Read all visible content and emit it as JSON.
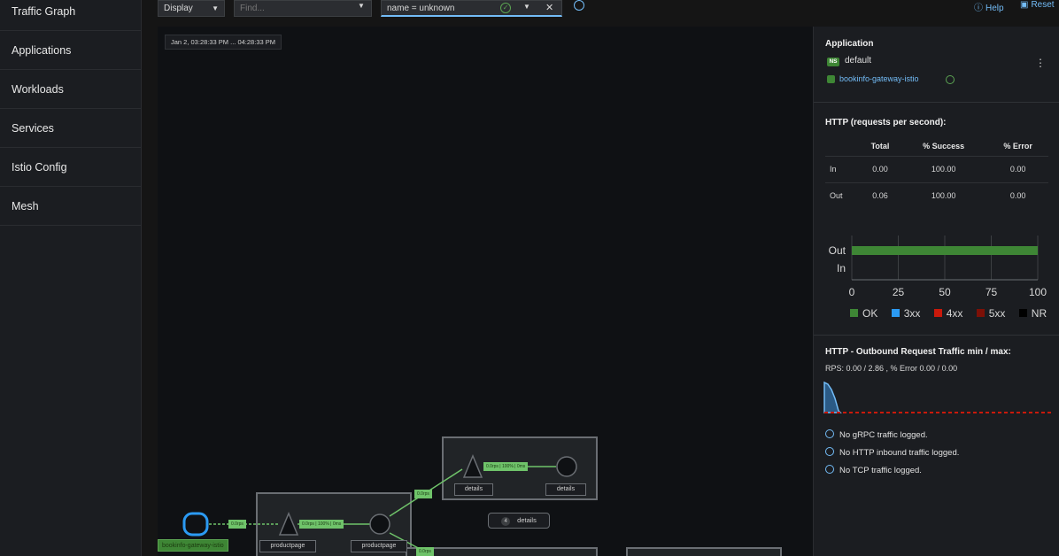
{
  "sidebar": {
    "items": [
      {
        "label": "Traffic Graph"
      },
      {
        "label": "Applications"
      },
      {
        "label": "Workloads"
      },
      {
        "label": "Services"
      },
      {
        "label": "Istio Config"
      },
      {
        "label": "Mesh"
      }
    ]
  },
  "toolbar": {
    "display_label": "Display",
    "find_placeholder": "Find...",
    "hide_value": "name = unknown",
    "help_label": "Help",
    "reset_label": "Reset"
  },
  "graph": {
    "time_range": "Jan 2, 03:28:33 PM ... 04:28:33 PM",
    "nodes": {
      "gateway": "bookinfo-gateway-istio",
      "productpage_a": "productpage",
      "productpage_b": "productpage",
      "details_a": "details",
      "details_b": "details"
    },
    "edge_labels": {
      "e1": "0.0rps",
      "e2": "0.0rps | 100% | 0ms",
      "e3": "0.0rps",
      "e4": "0.0rps | 100% | 0ms",
      "e5": "0.0rps"
    },
    "details_pill": {
      "count": "4",
      "label": "details"
    }
  },
  "panel": {
    "header": "Application",
    "namespace_badge": "NS",
    "namespace": "default",
    "app_name": "bookinfo-gateway-istio",
    "http_title": "HTTP (requests per second):",
    "table": {
      "headers": [
        "",
        "Total",
        "% Success",
        "% Error"
      ],
      "rows": [
        {
          "label": "In",
          "total": "0.00",
          "success": "100.00",
          "error": "0.00"
        },
        {
          "label": "Out",
          "total": "0.06",
          "success": "100.00",
          "error": "0.00"
        }
      ]
    },
    "outbound_title": "HTTP - Outbound Request Traffic min / max:",
    "rps_summary": "RPS: 0.00 / 2.86 , % Error 0.00 / 0.00",
    "info_messages": [
      "No gRPC traffic logged.",
      "No HTTP inbound traffic logged.",
      "No TCP traffic logged."
    ],
    "colors": {
      "ok": "#3e8635",
      "3xx": "#2b9af3",
      "4xx": "#c9190b",
      "5xx": "#7d1007",
      "nr": "#000000",
      "error_line": "#c9190b",
      "sparkline": "#73bcf7"
    }
  },
  "chart_data": {
    "type": "bar",
    "orientation": "horizontal",
    "categories": [
      "Out",
      "In"
    ],
    "series": [
      {
        "name": "OK",
        "values": [
          100,
          0
        ]
      },
      {
        "name": "3xx",
        "values": [
          0,
          0
        ]
      },
      {
        "name": "4xx",
        "values": [
          0,
          0
        ]
      },
      {
        "name": "5xx",
        "values": [
          0,
          0
        ]
      },
      {
        "name": "NR",
        "values": [
          0,
          0
        ]
      }
    ],
    "xlim": [
      0,
      100
    ],
    "xticks": [
      "0",
      "25",
      "50",
      "75",
      "100"
    ],
    "legend": [
      "OK",
      "3xx",
      "4xx",
      "5xx",
      "NR"
    ],
    "legend_position": "bottom",
    "grid": true
  }
}
